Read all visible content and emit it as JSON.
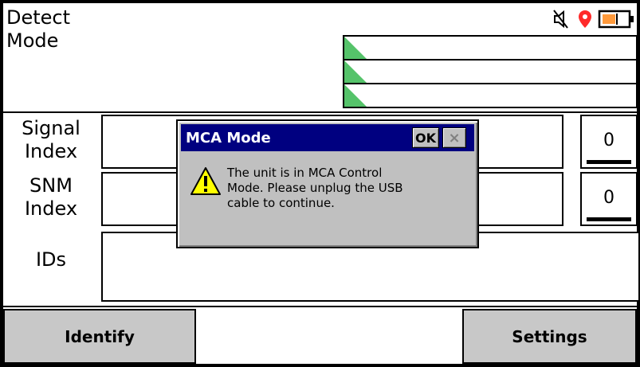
{
  "header": {
    "mode_label_line1": "Detect",
    "mode_label_line2": "Mode"
  },
  "status": {
    "icons": [
      "speaker-muted-icon",
      "location-pin-icon",
      "battery-icon"
    ],
    "accent_colors": {
      "pin": "#ff2a2a",
      "battery": "#ff9a3c",
      "bars": "#55c36a"
    }
  },
  "rows": {
    "signal": {
      "label_line1": "Signal",
      "label_line2": "Index",
      "value": "0"
    },
    "snm": {
      "label_line1": "SNM",
      "label_line2": "Index",
      "value": "0"
    },
    "ids": {
      "label": "IDs"
    }
  },
  "buttons": {
    "identify": "Identify",
    "settings": "Settings"
  },
  "dialog": {
    "title": "MCA Mode",
    "ok_label": "OK",
    "close_label": "×",
    "message_line1": "The unit is in MCA Control",
    "message_line2": "Mode. Please unplug the USB",
    "message_line3": "cable to continue."
  }
}
